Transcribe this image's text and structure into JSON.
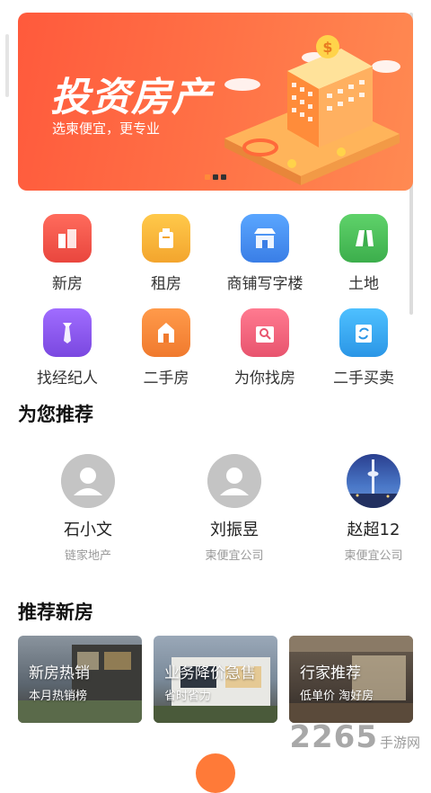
{
  "banner": {
    "title": "投资房产",
    "subtitle": "选柬便宜，更专业",
    "dots": [
      true,
      false,
      false
    ]
  },
  "categories": [
    {
      "label": "新房",
      "icon": "new-house-icon",
      "color": "#f05a4e"
    },
    {
      "label": "租房",
      "icon": "rent-icon",
      "color": "#f6b53b"
    },
    {
      "label": "商铺写字楼",
      "icon": "shop-icon",
      "color": "#4a90f0"
    },
    {
      "label": "土地",
      "icon": "land-icon",
      "color": "#4cc05a"
    },
    {
      "label": "找经纪人",
      "icon": "agent-icon",
      "color": "#8a5ae6"
    },
    {
      "label": "二手房",
      "icon": "second-hand-house-icon",
      "color": "#f5893a"
    },
    {
      "label": "为你找房",
      "icon": "find-house-icon",
      "color": "#f0617a"
    },
    {
      "label": "二手买卖",
      "icon": "trade-icon",
      "color": "#38a8ee"
    }
  ],
  "recommend": {
    "title": "为您推荐",
    "agents": [
      {
        "name": "石小文",
        "company": "链家地产"
      },
      {
        "name": "刘振昱",
        "company": "柬便宜公司"
      },
      {
        "name": "赵超12",
        "company": "柬便宜公司"
      }
    ]
  },
  "new_houses": {
    "title": "推荐新房",
    "cards": [
      {
        "title": "新房热销",
        "subtitle": "本月热销榜"
      },
      {
        "title": "业务降价急售",
        "subtitle": "省时省力"
      },
      {
        "title": "行家推荐",
        "subtitle": "低单价 淘好房"
      }
    ]
  },
  "watermark": {
    "number": "2265",
    "text": "手游网"
  }
}
